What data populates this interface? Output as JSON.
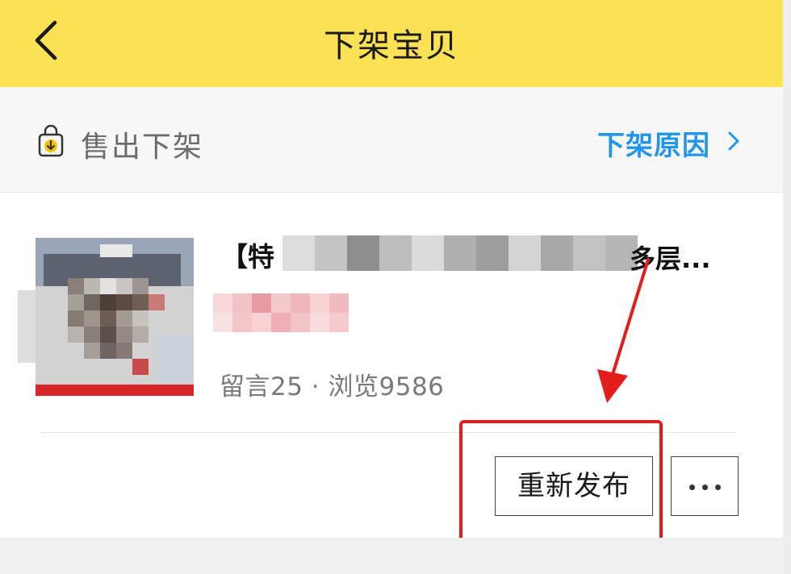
{
  "header": {
    "back_icon": "chevron-left-icon",
    "title": "下架宝贝",
    "background": "#fde154"
  },
  "status": {
    "icon": "shopping-bag-download-icon",
    "label": "售出下架",
    "reason_link": "下架原因",
    "reason_icon": "chevron-right-icon",
    "link_color": "#2196e8"
  },
  "item": {
    "title_start": "【特",
    "title_end": "多层...",
    "stats": "留言25 · 浏览9586"
  },
  "actions": {
    "republish_label": "重新发布",
    "more_icon": "ellipsis-icon"
  },
  "annotation": {
    "highlight_color": "#e51c1c"
  }
}
